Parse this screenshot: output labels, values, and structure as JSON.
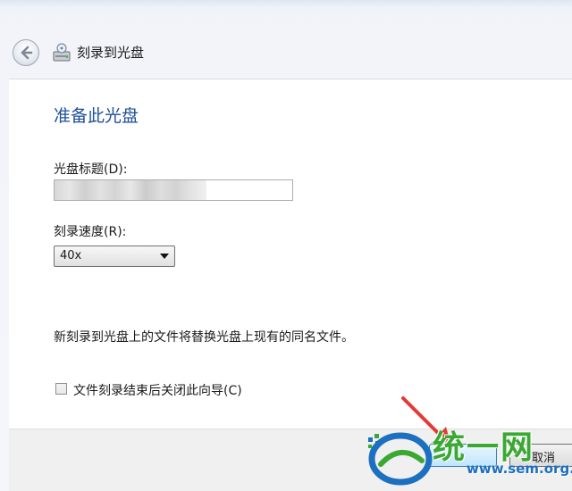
{
  "window": {
    "title": "刻录到光盘",
    "back_icon": "back-arrow-icon",
    "app_icon": "disc-burner-icon"
  },
  "content": {
    "heading": "准备此光盘",
    "disc_title": {
      "label": "光盘标题(D):",
      "value": ""
    },
    "burn_speed": {
      "label": "刻录速度(R):",
      "value": "40x"
    },
    "notice": "新刻录到光盘上的文件将替换光盘上现有的同名文件。",
    "close_wizard": {
      "label": "文件刻录结束后关闭此向导(C)",
      "checked": false
    }
  },
  "footer": {
    "next_label": "",
    "cancel_label": "取消"
  },
  "overlay": {
    "arrow_color": "#e53935",
    "watermark_text": "统一网",
    "watermark_url": "www.sem.org.cn"
  },
  "colors": {
    "heading": "#1e4f9a",
    "next_button_border": "#3c7fb1"
  }
}
